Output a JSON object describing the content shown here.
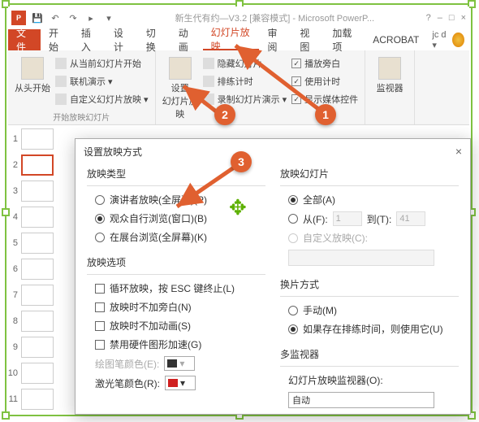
{
  "window": {
    "app_icon_text": "P",
    "doc_title": "新生代有约—V3.2 [兼容模式] - Microsoft PowerP...",
    "controls": {
      "help": "?",
      "min": "–",
      "max": "□",
      "close": "×"
    }
  },
  "qat": {
    "save": "💾",
    "undo": "↶",
    "redo": "↷",
    "start": "▸",
    "more": "▾"
  },
  "tabs": {
    "file": "文件",
    "home": "开始",
    "insert": "插入",
    "design": "设计",
    "transitions": "切换",
    "animations": "动画",
    "slideshow": "幻灯片放映",
    "review": "审阅",
    "view": "视图",
    "addins": "加载项",
    "acrobat": "ACROBAT",
    "user": "jc d ▾"
  },
  "ribbon": {
    "from_beginning": "从头开始",
    "from_current": "从当前幻灯片开始",
    "present_online": "联机演示 ▾",
    "custom_show": "自定义幻灯片放映 ▾",
    "group1_label": "开始放映幻灯片",
    "setup": "设置\n幻灯片放映",
    "hide_slide": "隐藏幻灯片",
    "rehearse": "排练计时",
    "record": "录制幻灯片演示 ▾",
    "group2_label": "",
    "play_narr": "播放旁白",
    "use_timings": "使用计时",
    "show_controls": "显示媒体控件",
    "monitor": "监视器",
    "group3_label": ""
  },
  "slides": [
    "1",
    "2",
    "3",
    "4",
    "5",
    "6",
    "7",
    "8",
    "9",
    "10",
    "11"
  ],
  "dialog": {
    "title": "设置放映方式",
    "close": "×",
    "left": {
      "type_title": "放映类型",
      "type_presenter": "演讲者放映(全屏幕)(P)",
      "type_browsed": "观众自行浏览(窗口)(B)",
      "type_kiosk": "在展台浏览(全屏幕)(K)",
      "opts_title": "放映选项",
      "opt_loop": "循环放映，按 ESC 键终止(L)",
      "opt_nonarr": "放映时不加旁白(N)",
      "opt_noanim": "放映时不加动画(S)",
      "opt_hwaccel": "禁用硬件图形加速(G)",
      "pen_label": "绘图笔颜色(E):",
      "laser_label": "激光笔颜色(R):"
    },
    "right": {
      "slides_title": "放映幻灯片",
      "all": "全部(A)",
      "from": "从(F):",
      "from_val": "1",
      "to": "到(T):",
      "to_val": "41",
      "custom": "自定义放映(C):",
      "advance_title": "换片方式",
      "manual": "手动(M)",
      "timed": "如果存在排练时间，则使用它(U)",
      "multi_title": "多监视器",
      "multi_label": "幻灯片放映监视器(O):",
      "multi_val": "自动"
    }
  },
  "badges": {
    "b1": "1",
    "b2": "2",
    "b3": "3"
  },
  "colors": {
    "pen": "#333333",
    "laser": "#d02020"
  }
}
